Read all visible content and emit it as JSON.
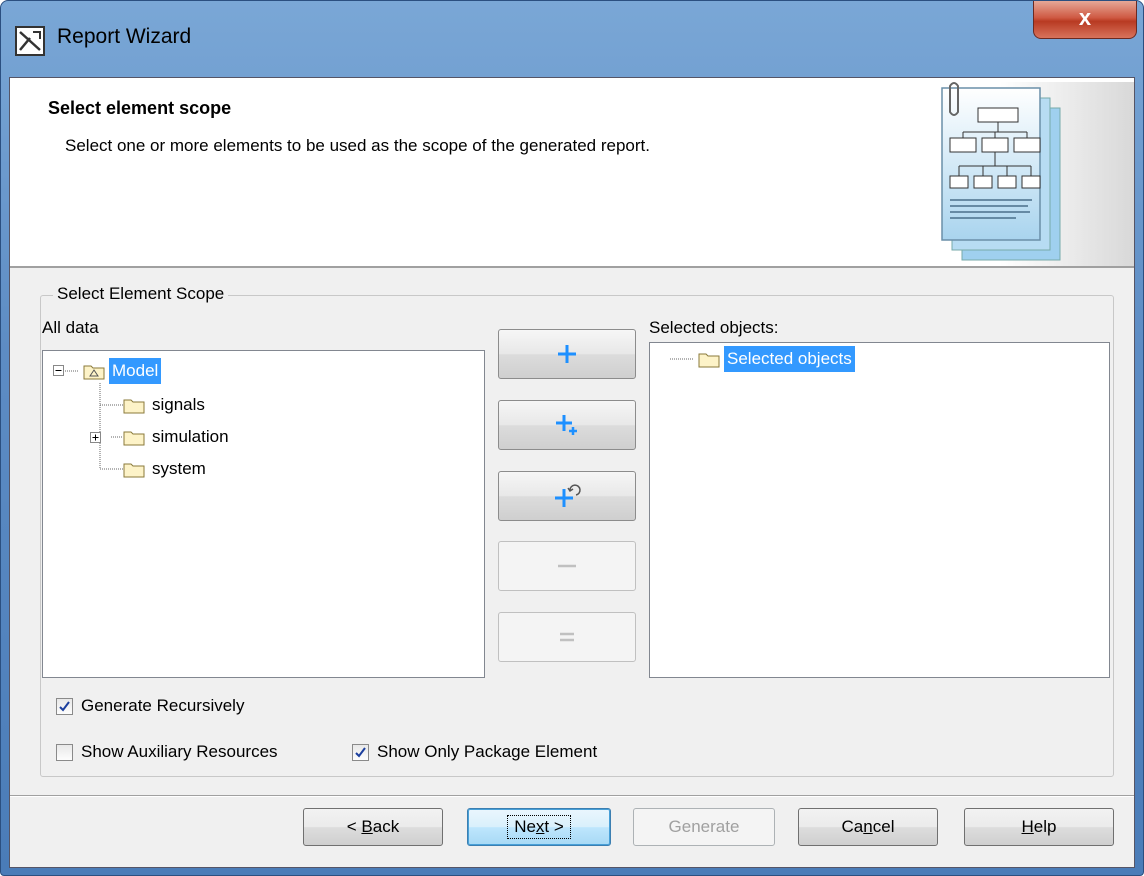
{
  "window": {
    "title": "Report Wizard",
    "close_label": "x"
  },
  "header": {
    "title": "Select element scope",
    "description": "Select one or more elements to be used as the scope of the generated report."
  },
  "scope_group": {
    "legend": "Select Element Scope",
    "all_data_label": "All data",
    "selected_label": "Selected objects:"
  },
  "all_data_tree": {
    "root": "Model",
    "children": [
      "signals",
      "simulation",
      "system"
    ]
  },
  "selected_tree": {
    "root": "Selected objects"
  },
  "transfer_buttons": {
    "add": "add-icon",
    "add_recursive": "add-recursive-icon",
    "add_refresh": "add-refresh-icon",
    "remove": "remove-icon",
    "remove_all": "remove-all-icon"
  },
  "options": {
    "generate_recursively": {
      "label": "Generate Recursively",
      "checked": true
    },
    "show_auxiliary": {
      "label": "Show Auxiliary Resources",
      "checked": false
    },
    "show_only_package": {
      "label": "Show Only Package Element",
      "checked": true
    }
  },
  "footer": {
    "back": {
      "pre": "< ",
      "mnemonic": "B",
      "post": "ack"
    },
    "next": {
      "pre": "Ne",
      "mnemonic": "x",
      "post": "t >"
    },
    "generate": "Generate",
    "cancel": {
      "pre": "Ca",
      "mnemonic": "n",
      "post": "cel"
    },
    "help": {
      "pre": "",
      "mnemonic": "H",
      "post": "elp"
    }
  },
  "colors": {
    "selection": "#3399ff",
    "accent_blue": "#1e90ff"
  }
}
